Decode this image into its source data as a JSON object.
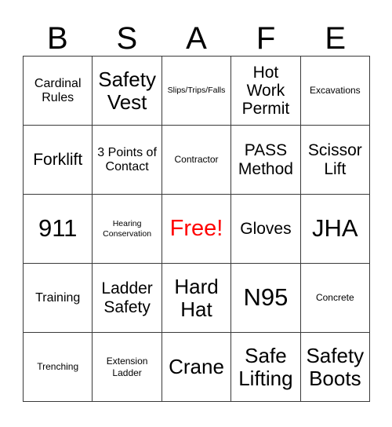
{
  "card": {
    "title_letters": [
      "B",
      "S",
      "A",
      "F",
      "E"
    ],
    "free_color": "#ff0000",
    "border_color": "#3a3a3a",
    "rows": [
      [
        {
          "label": "Cardinal Rules",
          "size": "fs-m",
          "free": false
        },
        {
          "label": "Safety Vest",
          "size": "fs-xl",
          "free": false
        },
        {
          "label": "Slips/Trips/Falls",
          "size": "fs-xs",
          "free": false
        },
        {
          "label": "Hot Work Permit",
          "size": "fs-l",
          "free": false
        },
        {
          "label": "Excavations",
          "size": "fs-s",
          "free": false
        }
      ],
      [
        {
          "label": "Forklift",
          "size": "fs-l",
          "free": false
        },
        {
          "label": "3 Points of Contact",
          "size": "fs-m",
          "free": false
        },
        {
          "label": "Contractor",
          "size": "fs-s",
          "free": false
        },
        {
          "label": "PASS Method",
          "size": "fs-l",
          "free": false
        },
        {
          "label": "Scissor Lift",
          "size": "fs-l",
          "free": false
        }
      ],
      [
        {
          "label": "911",
          "size": "fs-xxl",
          "free": false
        },
        {
          "label": "Hearing Conservation",
          "size": "fs-xs",
          "free": false
        },
        {
          "label": "Free!",
          "size": "fs-xl",
          "free": true
        },
        {
          "label": "Gloves",
          "size": "fs-l",
          "free": false
        },
        {
          "label": "JHA",
          "size": "fs-xxl",
          "free": false
        }
      ],
      [
        {
          "label": "Training",
          "size": "fs-m",
          "free": false
        },
        {
          "label": "Ladder Safety",
          "size": "fs-l",
          "free": false
        },
        {
          "label": "Hard Hat",
          "size": "fs-xl",
          "free": false
        },
        {
          "label": "N95",
          "size": "fs-xxl",
          "free": false
        },
        {
          "label": "Concrete",
          "size": "fs-s",
          "free": false
        }
      ],
      [
        {
          "label": "Trenching",
          "size": "fs-s",
          "free": false
        },
        {
          "label": "Extension Ladder",
          "size": "fs-s",
          "free": false
        },
        {
          "label": "Crane",
          "size": "fs-xl",
          "free": false
        },
        {
          "label": "Safe Lifting",
          "size": "fs-xl",
          "free": false
        },
        {
          "label": "Safety Boots",
          "size": "fs-xl",
          "free": false
        }
      ]
    ]
  }
}
